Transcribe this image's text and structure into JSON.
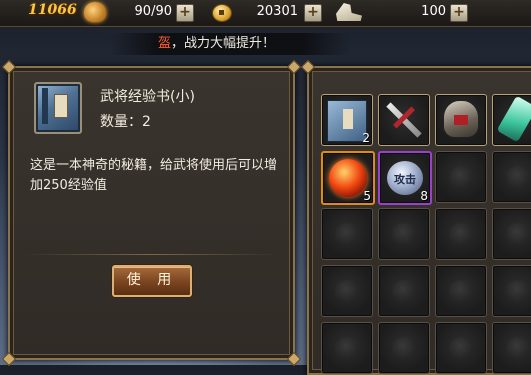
{
  "topbar": {
    "power": "11066",
    "stamina": "90/90",
    "gold": "20301",
    "energy": "100",
    "plus_label": "+",
    "icons": [
      "power-icon",
      "coin-icon",
      "boot-icon"
    ]
  },
  "notice": {
    "highlight": "盔",
    "text": "，战力大幅提升！"
  },
  "detail": {
    "item_name": "武将经验书(小)",
    "quantity": "数量：2",
    "description": "这是一本神奇的秘籍，给武将使用后可以增加250经验值",
    "use_button": "使 用"
  },
  "inventory": {
    "slots": [
      {
        "icon": "exp-book-icon",
        "count": "2",
        "rarity": "normal"
      },
      {
        "icon": "sword-icon",
        "count": "",
        "rarity": "normal"
      },
      {
        "icon": "helmet-icon",
        "count": "",
        "rarity": "normal"
      },
      {
        "icon": "jade-icon",
        "count": "",
        "rarity": "normal"
      },
      {
        "icon": "fire-orb-icon",
        "count": "5",
        "rarity": "orange"
      },
      {
        "icon": "gem-stone-icon",
        "count": "8",
        "rarity": "purple",
        "text": "攻击"
      }
    ],
    "empty_slot_count": 14
  },
  "colors": {
    "power_text": "#f6c845",
    "notice_highlight": "#ff5b2b",
    "panel_border": "#8a7450",
    "button": "#7a4420",
    "purple_rarity": "#9b3fd1",
    "orange_rarity": "#e08a1c"
  }
}
